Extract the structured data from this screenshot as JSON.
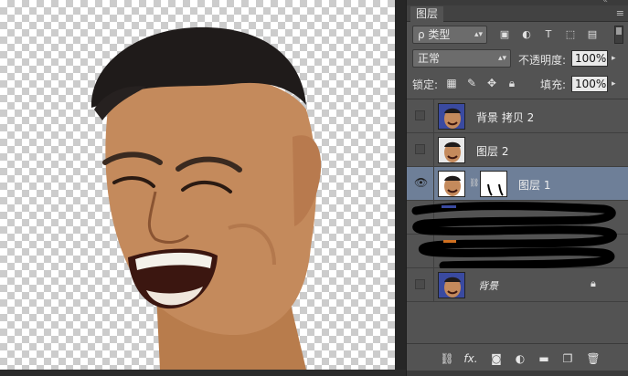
{
  "panel": {
    "tab_label": "图层",
    "close_glyph": "«",
    "menu_glyph": "≡"
  },
  "filter": {
    "selected": "ρ 类型",
    "icons": [
      "image-filter-icon",
      "adjustment-filter-icon",
      "type-filter-icon",
      "shape-filter-icon",
      "smart-object-filter-icon"
    ]
  },
  "blend": {
    "mode": "正常",
    "opacity_label": "不透明度:",
    "opacity_value": "100%"
  },
  "lock": {
    "label": "锁定:",
    "fill_label": "填充:",
    "fill_value": "100%"
  },
  "layers": [
    {
      "name": "背景 拷贝 2",
      "visible": false,
      "selected": false
    },
    {
      "name": "图层 2",
      "visible": false,
      "selected": false
    },
    {
      "name": "图层 1",
      "visible": true,
      "selected": true,
      "has_mask": true
    },
    {
      "name": "",
      "visible": false,
      "selected": false,
      "redacted": true
    },
    {
      "name": "",
      "visible": false,
      "selected": false,
      "redacted": true
    },
    {
      "name": "背景",
      "visible": false,
      "selected": false,
      "locked": true
    }
  ],
  "footer": {
    "fx_label": "fx."
  }
}
